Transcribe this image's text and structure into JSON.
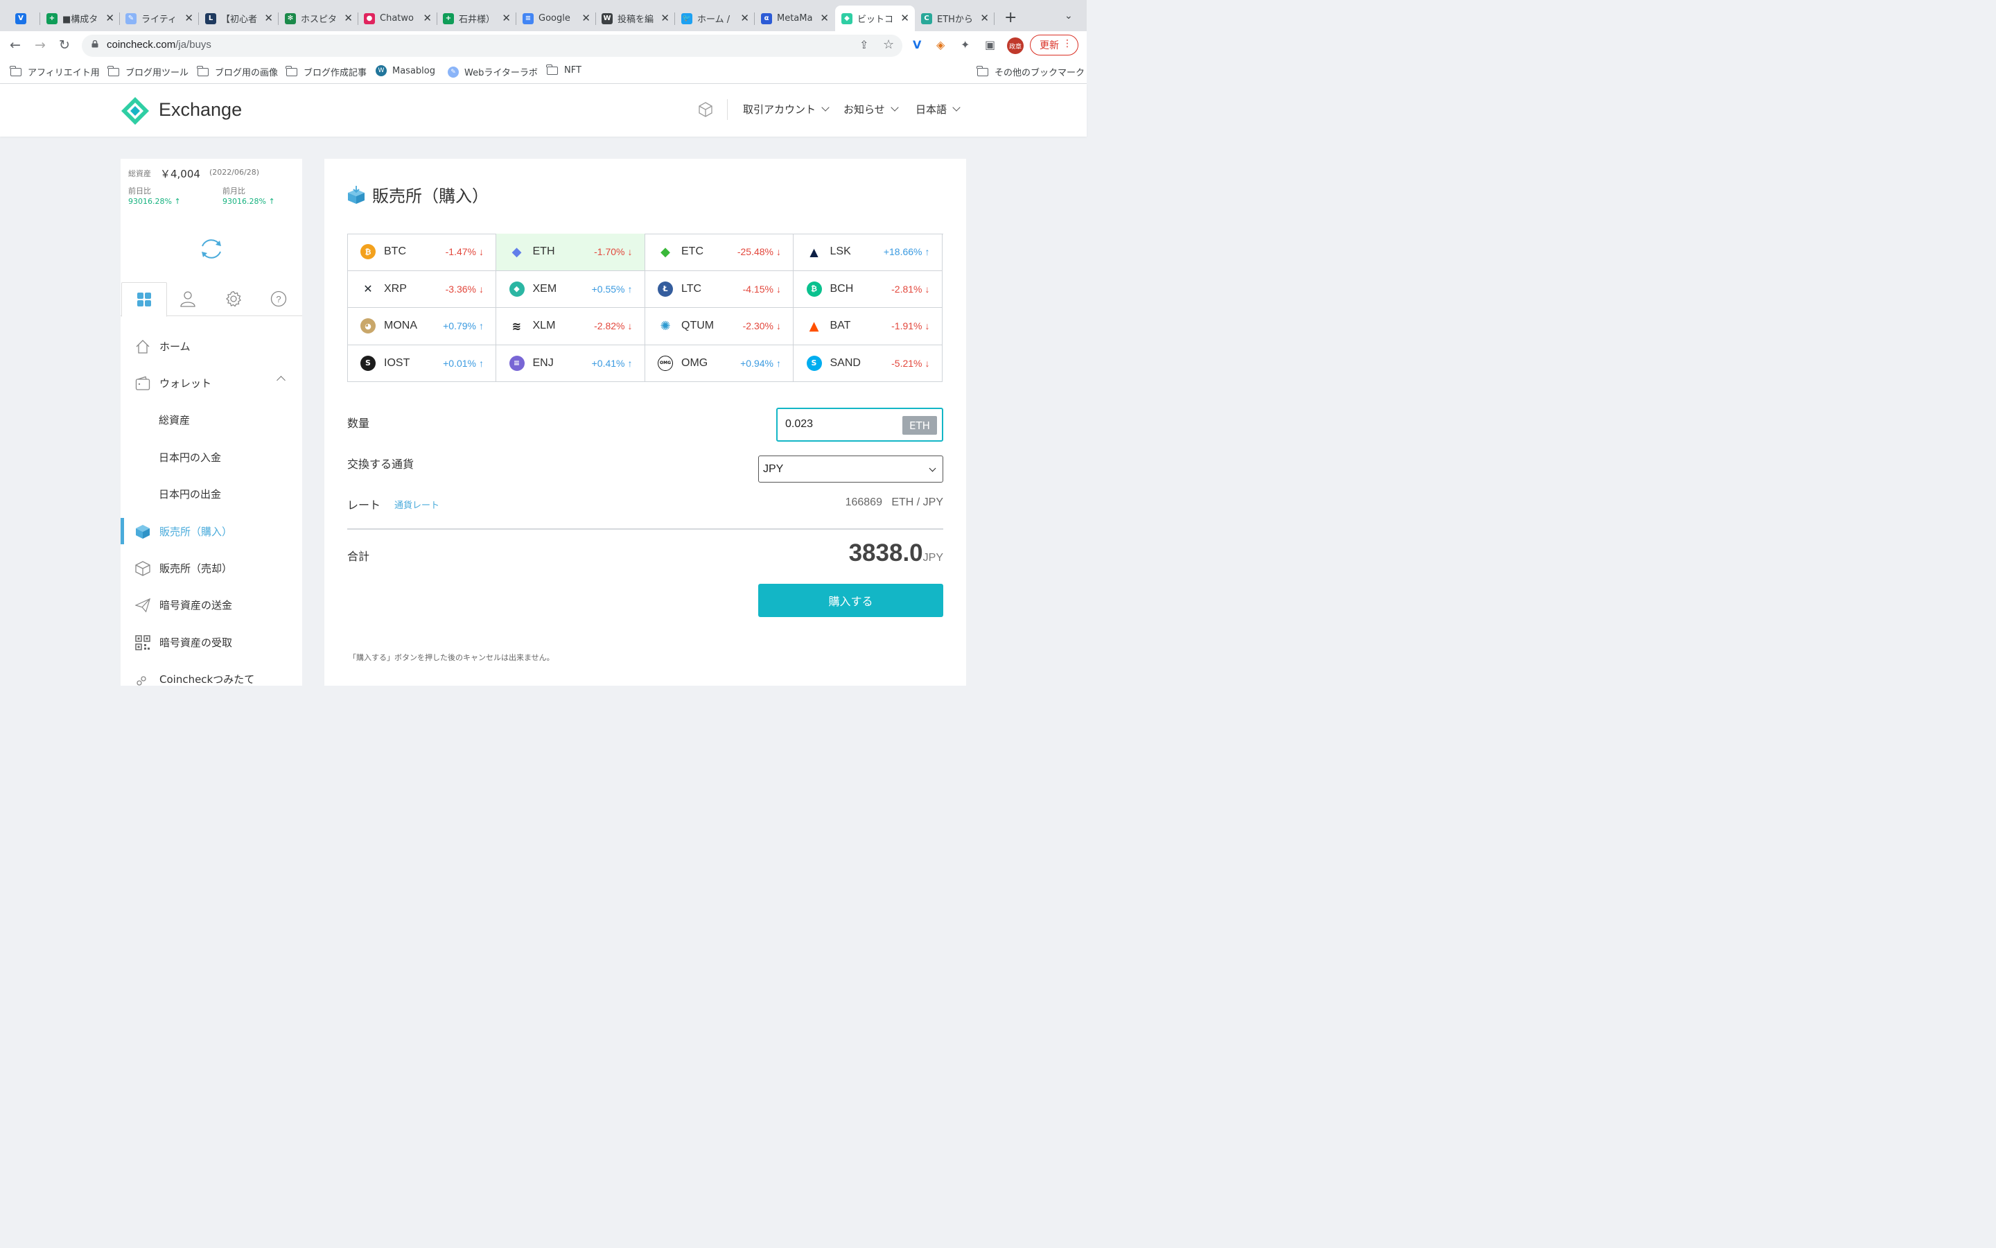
{
  "browser": {
    "tabs": [
      {
        "title": "",
        "color": "#1a73e8",
        "glyph": "V"
      },
      {
        "title": "■構成タ",
        "color": "#0f9d58",
        "glyph": "+"
      },
      {
        "title": "ライティ",
        "color": "#8ab4f8",
        "glyph": "✎"
      },
      {
        "title": "【初心者",
        "color": "#1f3a5f",
        "glyph": "L"
      },
      {
        "title": "ホスピタ",
        "color": "#1b8a4a",
        "glyph": "✻"
      },
      {
        "title": "Chatwo",
        "color": "#e0245e",
        "glyph": "●"
      },
      {
        "title": "石井様）",
        "color": "#0f9d58",
        "glyph": "+"
      },
      {
        "title": "Google",
        "color": "#4285f4",
        "glyph": "≡"
      },
      {
        "title": "投稿を編",
        "color": "#3c4043",
        "glyph": "W"
      },
      {
        "title": "ホーム /",
        "color": "#1da1f2",
        "glyph": "🐦"
      },
      {
        "title": "MetaMa",
        "color": "#2c5bd6",
        "glyph": "α"
      },
      {
        "title": "ビットコ",
        "color": "#2fcea4",
        "glyph": "◆"
      },
      {
        "title": "ETHから",
        "color": "#29a899",
        "glyph": "C"
      }
    ],
    "url_host": "coincheck.com",
    "url_path": "/ja/buys",
    "avatar_label": "政章",
    "update_label": "更新",
    "bookmarks": [
      {
        "label": "アフィリエイト用",
        "type": "folder"
      },
      {
        "label": "ブログ用ツール",
        "type": "folder"
      },
      {
        "label": "ブログ用の画像",
        "type": "folder"
      },
      {
        "label": "ブログ作成記事",
        "type": "folder"
      },
      {
        "label": "Masablog",
        "type": "site"
      },
      {
        "label": "Webライターラボ",
        "type": "site"
      },
      {
        "label": "NFT",
        "type": "folder"
      }
    ],
    "other_bookmarks": "その他のブックマーク"
  },
  "header": {
    "logo_text": "Exchange",
    "nav": [
      "取引アカウント",
      "お知らせ",
      "日本語"
    ]
  },
  "sidebar": {
    "total_label": "総資産",
    "total_value": "￥4,004",
    "total_date": "(2022/06/28)",
    "day_label": "前日比",
    "day_value": "93016.28%",
    "month_label": "前月比",
    "month_value": "93016.28%",
    "menu": [
      {
        "label": "ホーム"
      },
      {
        "label": "ウォレット"
      },
      {
        "label": "総資産"
      },
      {
        "label": "日本円の入金"
      },
      {
        "label": "日本円の出金"
      },
      {
        "label": "販売所（購入）"
      },
      {
        "label": "販売所（売却）"
      },
      {
        "label": "暗号資産の送金"
      },
      {
        "label": "暗号資産の受取"
      },
      {
        "label": "Coincheckつみたて"
      }
    ]
  },
  "main": {
    "title": "販売所（購入）",
    "coins": [
      {
        "symbol": "BTC",
        "change": "-1.47%",
        "dir": "down",
        "color": "#f3a11d",
        "glyph": "₿"
      },
      {
        "symbol": "ETH",
        "change": "-1.70%",
        "dir": "down",
        "color": "#627eea",
        "glyph": "◆"
      },
      {
        "symbol": "ETC",
        "change": "-25.48%",
        "dir": "down",
        "color": "#3ab83a",
        "glyph": "◆"
      },
      {
        "symbol": "LSK",
        "change": "+18.66%",
        "dir": "up",
        "color": "#0d1f45",
        "glyph": "▲"
      },
      {
        "symbol": "XRP",
        "change": "-3.36%",
        "dir": "down",
        "color": "#23292f",
        "glyph": "✕"
      },
      {
        "symbol": "XEM",
        "change": "+0.55%",
        "dir": "up",
        "color": "#2bb6a3",
        "glyph": "◆"
      },
      {
        "symbol": "LTC",
        "change": "-4.15%",
        "dir": "down",
        "color": "#345d9d",
        "glyph": "Ł"
      },
      {
        "symbol": "BCH",
        "change": "-2.81%",
        "dir": "down",
        "color": "#0ac18e",
        "glyph": "₿"
      },
      {
        "symbol": "MONA",
        "change": "+0.79%",
        "dir": "up",
        "color": "#c9a76a",
        "glyph": "◕"
      },
      {
        "symbol": "XLM",
        "change": "-2.82%",
        "dir": "down",
        "color": "#1c1c1c",
        "glyph": "≋"
      },
      {
        "symbol": "QTUM",
        "change": "-2.30%",
        "dir": "down",
        "color": "#2e9ad0",
        "glyph": "✺"
      },
      {
        "symbol": "BAT",
        "change": "-1.91%",
        "dir": "down",
        "color": "#ff5000",
        "glyph": "▲"
      },
      {
        "symbol": "IOST",
        "change": "+0.01%",
        "dir": "up",
        "color": "#1c1c1c",
        "glyph": "S"
      },
      {
        "symbol": "ENJ",
        "change": "+0.41%",
        "dir": "up",
        "color": "#7866d5",
        "glyph": "≡"
      },
      {
        "symbol": "OMG",
        "change": "+0.94%",
        "dir": "up",
        "color": "#1a1a1a",
        "glyph": "OMG"
      },
      {
        "symbol": "SAND",
        "change": "-5.21%",
        "dir": "down",
        "color": "#00adef",
        "glyph": "S"
      }
    ],
    "qty_label": "数量",
    "qty_value": "0.023",
    "qty_unit": "ETH",
    "currency_label": "交換する通貨",
    "currency_value": "JPY",
    "rate_label": "レート",
    "rate_link": "通貨レート",
    "rate_value": "166869",
    "rate_unit": "ETH / JPY",
    "total_label": "合計",
    "total_value": "3838.0",
    "total_unit": "JPY",
    "buy_button": "購入する",
    "note": "「購入する」ボタンを押した後のキャンセルは出来ません。"
  },
  "colors": {
    "accent": "#13b6c6",
    "link": "#4aabdb",
    "up": "#3a9ae0",
    "down": "#e2473c",
    "positive": "#16b27f"
  }
}
